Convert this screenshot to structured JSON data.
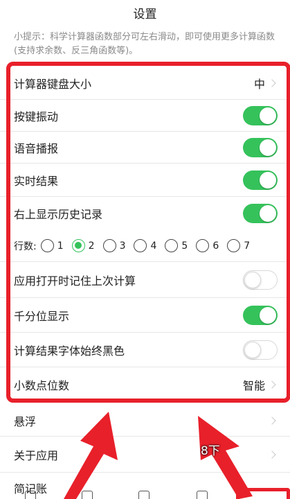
{
  "header": {
    "title": "设置"
  },
  "hint": "小提示：科学计算器函数部分可左右滑动，即可使用更多计算函数(支持求余数、反三角函数等)。",
  "settings": {
    "keyboard_size": {
      "label": "计算器键盘大小",
      "value": "中"
    },
    "key_vibration": {
      "label": "按键振动",
      "on": true
    },
    "voice": {
      "label": "语音播报",
      "on": true
    },
    "realtime": {
      "label": "实时结果",
      "on": true
    },
    "history": {
      "label": "右上显示历史记录",
      "on": true
    },
    "rows": {
      "label": "行数:",
      "options": [
        "1",
        "2",
        "3",
        "4",
        "5",
        "6",
        "7"
      ],
      "selected": "2"
    },
    "remember_last": {
      "label": "应用打开时记住上次计算",
      "on": false
    },
    "thousands": {
      "label": "千分位显示",
      "on": true
    },
    "black_font": {
      "label": "计算结果字体始终黑色",
      "on": false
    },
    "decimals": {
      "label": "小数点位数",
      "value": "智能"
    },
    "float": {
      "label": "悬浮"
    },
    "about": {
      "label": "关于应用"
    },
    "ledger": {
      "label": "简记账"
    }
  },
  "overlay": {
    "text": "8下"
  },
  "colors": {
    "accent": "#35c25b",
    "annotation": "#e8202a"
  }
}
